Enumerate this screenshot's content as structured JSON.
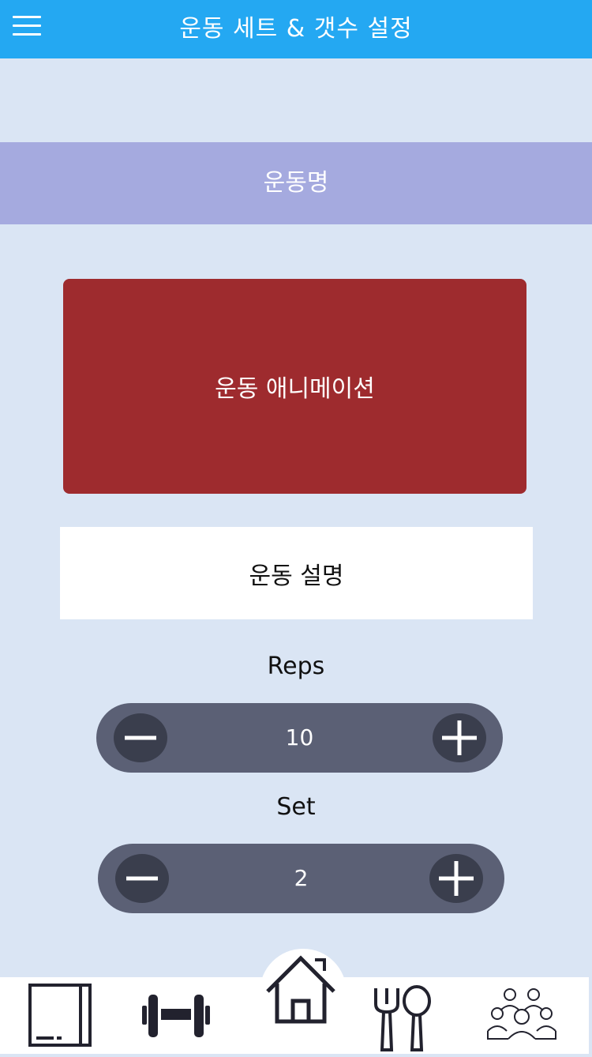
{
  "header": {
    "title": "운동 세트 & 갯수 설정",
    "background_color": "#24a8f2",
    "menu_icon": "hamburger-menu-icon"
  },
  "exercise": {
    "name": "운동명",
    "animation_placeholder": "운동 애니메이션",
    "description": "운동 설명"
  },
  "reps": {
    "label": "Reps",
    "value": "10",
    "decrement_icon": "minus-icon",
    "increment_icon": "plus-icon"
  },
  "sets": {
    "label": "Set",
    "value": "2",
    "decrement_icon": "minus-icon",
    "increment_icon": "plus-icon"
  },
  "bottom_nav": {
    "items": [
      {
        "icon": "notebook-icon"
      },
      {
        "icon": "dumbbell-icon"
      },
      {
        "icon": "home-icon"
      },
      {
        "icon": "fork-spoon-icon"
      },
      {
        "icon": "community-icon"
      }
    ]
  },
  "colors": {
    "page_background": "#dae5f4",
    "name_band": "#a5aadf",
    "animation_box": "#9e2b2e",
    "stepper": "#5b6075",
    "nav_icon": "#22222e"
  }
}
